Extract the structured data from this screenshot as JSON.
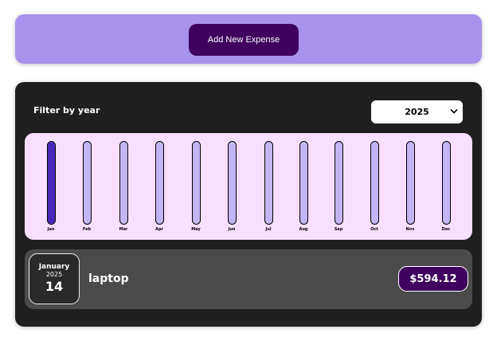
{
  "new_expense": {
    "add_button_label": "Add New Expense"
  },
  "filter": {
    "label": "Filter by year",
    "selected_year": "2025"
  },
  "chart_data": {
    "type": "bar",
    "categories": [
      "Jan",
      "Feb",
      "Mar",
      "Apr",
      "May",
      "Jun",
      "Jul",
      "Aug",
      "Sep",
      "Oct",
      "Nov",
      "Dec"
    ],
    "values": [
      594.12,
      0,
      0,
      0,
      0,
      0,
      0,
      0,
      0,
      0,
      0,
      0
    ],
    "fill_fractions": [
      1,
      0,
      0,
      0,
      0,
      0,
      0,
      0,
      0,
      0,
      0,
      0
    ]
  },
  "expenses": [
    {
      "month": "January",
      "year": "2025",
      "day": "14",
      "title": "laptop",
      "amount": "$594.12"
    }
  ],
  "colors": {
    "accent": "#a892ec",
    "button": "#40005d",
    "bar_fill": "#4826b9",
    "bar_empty": "#c3b4f3",
    "chart_bg": "#f8dfff",
    "panel_bg": "#1f1f1f",
    "item_bg": "#4b4b4b"
  }
}
